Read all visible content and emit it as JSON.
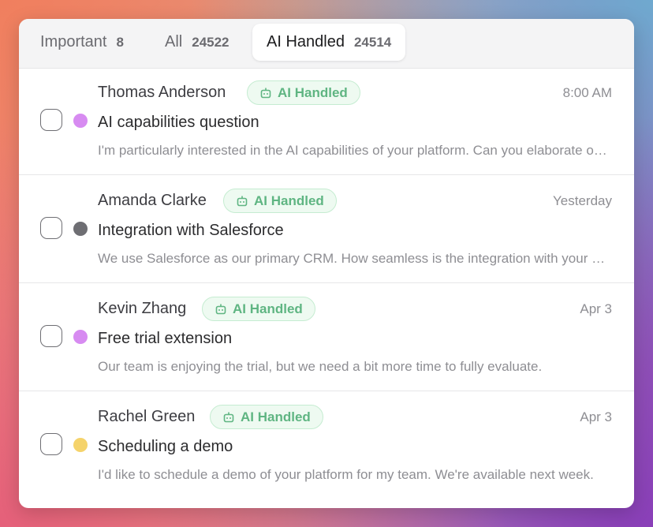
{
  "tabs": [
    {
      "label": "Important",
      "count": "8",
      "active": false
    },
    {
      "label": "All",
      "count": "24522",
      "active": false
    },
    {
      "label": "AI Handled",
      "count": "24514",
      "active": true
    }
  ],
  "messages": [
    {
      "sender": "Thomas Anderson",
      "badge": "AI Handled",
      "time": "8:00 AM",
      "subject": "AI capabilities question",
      "preview": "I'm particularly interested in the AI capabilities of your platform. Can you elaborate on how it works?",
      "dot_color": "#d78bf1"
    },
    {
      "sender": "Amanda Clarke",
      "badge": "AI Handled",
      "time": "Yesterday",
      "subject": "Integration with Salesforce",
      "preview": "We use Salesforce as our primary CRM. How seamless is the integration with your platform?",
      "dot_color": "#6e6e73"
    },
    {
      "sender": "Kevin Zhang",
      "badge": "AI Handled",
      "time": "Apr 3",
      "subject": "Free trial extension",
      "preview": "Our team is enjoying the trial, but we need a bit more time to fully evaluate.",
      "dot_color": "#d78bf1"
    },
    {
      "sender": "Rachel Green",
      "badge": "AI Handled",
      "time": "Apr 3",
      "subject": "Scheduling a demo",
      "preview": "I'd like to schedule a demo of your platform for my team. We're available next week.",
      "dot_color": "#f5d36b"
    }
  ],
  "icons": {
    "badge_icon": "robot-icon"
  },
  "colors": {
    "badge_text": "#5fb582",
    "badge_bg": "#eefaf1",
    "badge_border": "#c5ecd1"
  }
}
